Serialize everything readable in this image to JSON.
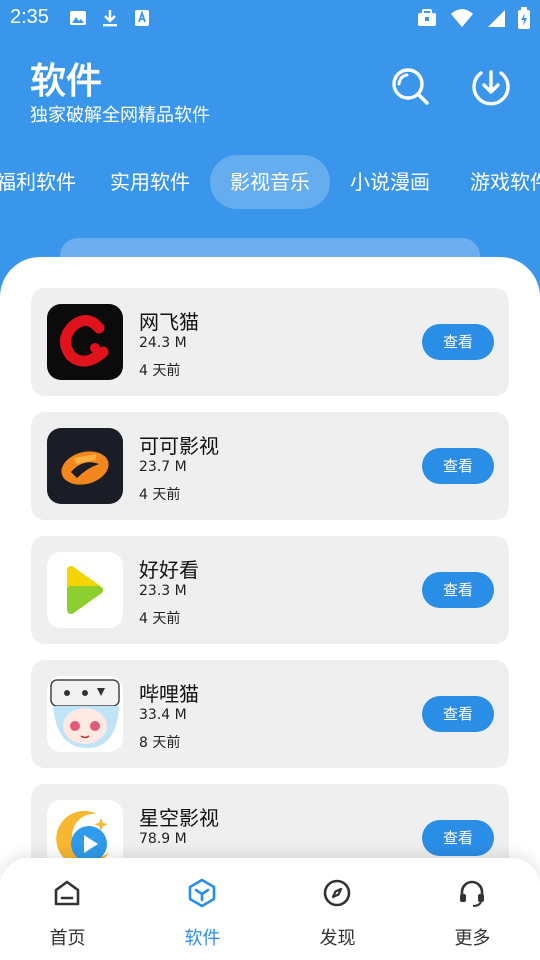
{
  "status_bar": {
    "time": "2:35"
  },
  "header": {
    "title": "软件",
    "subtitle": "独家破解全网精品软件"
  },
  "tabs": [
    "福利软件",
    "实用软件",
    "影视音乐",
    "小说漫画",
    "游戏软件"
  ],
  "active_tab": "影视音乐",
  "apps": [
    {
      "name": "网飞猫",
      "size": "24.3 M",
      "time": "4 天前",
      "action": "查看"
    },
    {
      "name": "可可影视",
      "size": "23.7 M",
      "time": "4 天前",
      "action": "查看"
    },
    {
      "name": "好好看",
      "size": "23.3 M",
      "time": "4 天前",
      "action": "查看"
    },
    {
      "name": "哔哩猫",
      "size": "33.4 M",
      "time": "8 天前",
      "action": "查看"
    },
    {
      "name": "星空影视",
      "size": "78.9 M",
      "time": "",
      "action": "查看"
    }
  ],
  "bottom_nav": [
    {
      "label": "首页",
      "icon": "home-icon"
    },
    {
      "label": "软件",
      "icon": "cube-icon"
    },
    {
      "label": "发现",
      "icon": "compass-icon"
    },
    {
      "label": "更多",
      "icon": "headset-icon"
    }
  ],
  "active_nav": "软件",
  "colors": {
    "primary": "#3a96ea",
    "button": "#2b8ee6",
    "card_bg": "#efefef"
  }
}
